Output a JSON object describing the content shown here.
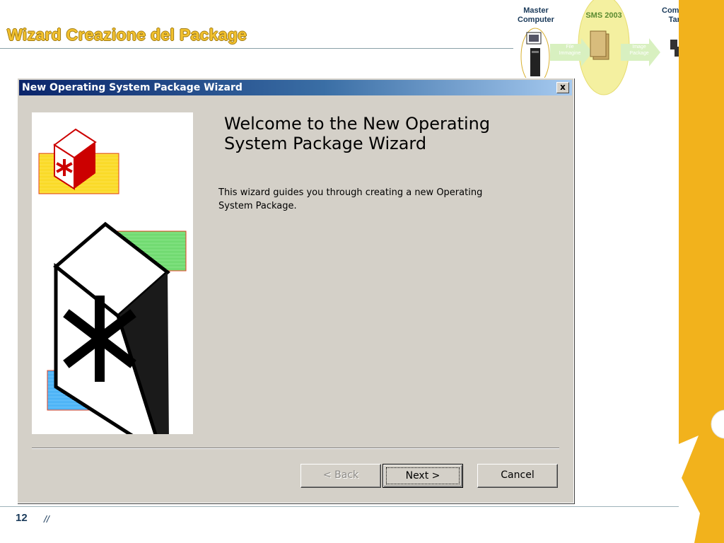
{
  "slide": {
    "title": "Wizard Creazione del Package",
    "page_number": "12",
    "page_separator": "//"
  },
  "flow": {
    "master_label_1": "Master",
    "master_label_2": "Computer",
    "sms_label": "SMS 2003",
    "target_label_1": "Computer",
    "target_label_2": "Target",
    "arrow1_label_1": "File",
    "arrow1_label_2": "Immagine",
    "arrow2_label_1": "Image",
    "arrow2_label_2": "Package"
  },
  "wizard": {
    "window_title": "New Operating System Package Wizard",
    "close_glyph": "x",
    "heading_line1": "Welcome to the New Operating",
    "heading_line2": "System Package Wizard",
    "description_line1": "This wizard guides you through creating a new Operating",
    "description_line2": "System Package.",
    "buttons": {
      "back": "< Back",
      "next": "Next >",
      "cancel": "Cancel"
    }
  },
  "colors": {
    "accent_yellow": "#f2b21c",
    "titlebar_start": "#0a246a",
    "titlebar_end": "#a6caf0",
    "dialog_face": "#d4d0c8"
  }
}
